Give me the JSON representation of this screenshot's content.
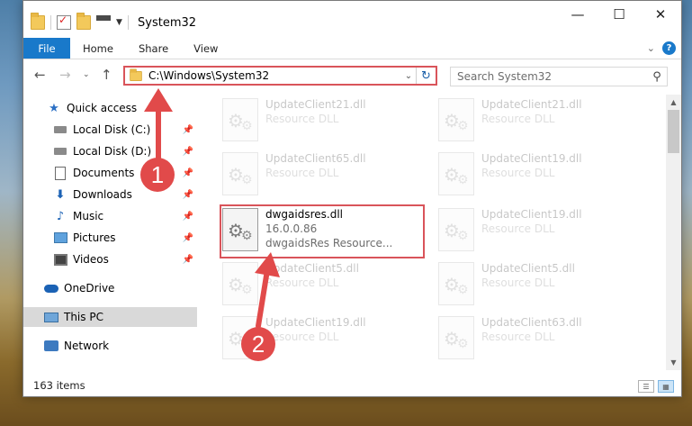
{
  "window": {
    "title": "System32",
    "controls": {
      "minimize": "—",
      "maximize": "☐",
      "close": "✕"
    }
  },
  "ribbon": {
    "tabs": [
      "File",
      "Home",
      "Share",
      "View"
    ]
  },
  "navigation": {
    "address": "C:\\Windows\\System32",
    "search_placeholder": "Search System32"
  },
  "sidebar": {
    "items": [
      {
        "label": "Quick access",
        "icon": "star-icon",
        "pinned": false,
        "indent": 1
      },
      {
        "label": "Local Disk (C:)",
        "icon": "drive-icon",
        "pinned": true,
        "indent": 2
      },
      {
        "label": "Local Disk (D:)",
        "icon": "drive-icon",
        "pinned": true,
        "indent": 2
      },
      {
        "label": "Documents",
        "icon": "documents-icon",
        "pinned": true,
        "indent": 2
      },
      {
        "label": "Downloads",
        "icon": "downloads-icon",
        "pinned": true,
        "indent": 2
      },
      {
        "label": "Music",
        "icon": "music-icon",
        "pinned": true,
        "indent": 2
      },
      {
        "label": "Pictures",
        "icon": "pictures-icon",
        "pinned": true,
        "indent": 2
      },
      {
        "label": "Videos",
        "icon": "videos-icon",
        "pinned": true,
        "indent": 2
      },
      {
        "label": "OneDrive",
        "icon": "onedrive-icon",
        "pinned": false,
        "indent": 1
      },
      {
        "label": "This PC",
        "icon": "this-pc-icon",
        "pinned": false,
        "indent": 1,
        "selected": true
      },
      {
        "label": "Network",
        "icon": "network-icon",
        "pinned": false,
        "indent": 1
      }
    ]
  },
  "files": {
    "highlighted": {
      "name": "dwgaidsres.dll",
      "version": "16.0.0.86",
      "description": "dwgaidsRes Resource..."
    },
    "left_column": [
      {
        "name": "UpdateClient21.dll",
        "description": "Resource DLL"
      },
      {
        "name": "UpdateClient65.dll",
        "description": "Resource DLL"
      },
      {
        "name": "UpdateClient5.dll",
        "description": "Resource DLL"
      },
      {
        "name": "UpdateClient19.dll",
        "description": "Resource DLL"
      }
    ],
    "right_column": [
      {
        "name": "UpdateClient21.dll",
        "description": "Resource DLL"
      },
      {
        "name": "UpdateClient19.dll",
        "description": "Resource DLL"
      },
      {
        "name": "UpdateClient19.dll",
        "description": "Resource DLL"
      },
      {
        "name": "UpdateClient5.dll",
        "description": "Resource DLL"
      },
      {
        "name": "UpdateClient63.dll",
        "description": "Resource DLL"
      }
    ]
  },
  "status": {
    "item_count": "163 items"
  },
  "annotations": {
    "step1": "1",
    "step2": "2",
    "accent_color": "#e14a4a"
  }
}
